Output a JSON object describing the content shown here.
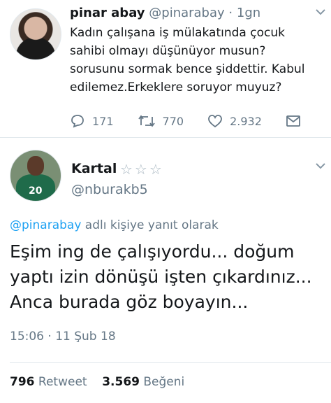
{
  "tweet1": {
    "name": "pinar abay",
    "handle": "@pinarabay",
    "dot": "·",
    "time": "1gn",
    "text": "Kadın çalışana iş mülakatında çocuk sahibi olmayı düşünüyor musun? sorusunu sormak bence şiddettir. Kabul edilemez.Erkeklere soruyor muyuz?",
    "replies": "171",
    "retweets": "770",
    "likes": "2.932"
  },
  "tweet2": {
    "name": "Kartal",
    "stars": "☆☆☆",
    "handle": "@nburakb5",
    "reply_mention": "@pinarabay",
    "reply_suffix": " adlı kişiye yanıt olarak",
    "text": "Eşim ing de çalışıyordu... doğum\nyaptı izin dönüşü işten çıkardınız...\nAnca burada göz boyayın...",
    "timestamp": "15:06 · 11 Şub 18",
    "retweet_count": "796",
    "retweet_label": "Retweet",
    "like_count": "3.569",
    "like_label": "Beğeni",
    "avatar_jersey_number": "20"
  },
  "colors": {
    "accent": "#1da1f2",
    "muted": "#657786",
    "text": "#14171a",
    "divider": "#e1e8ed"
  }
}
